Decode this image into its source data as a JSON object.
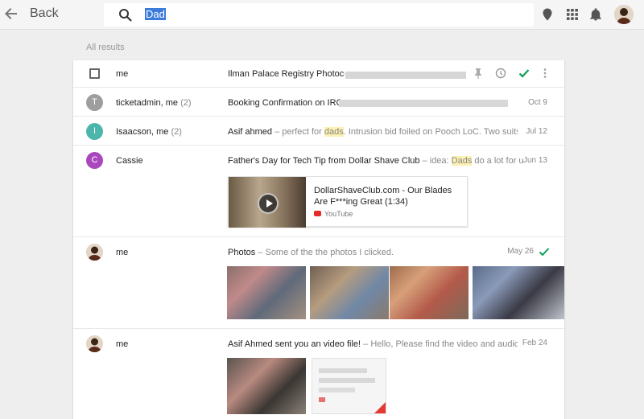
{
  "topbar": {
    "back_label": "Back",
    "search_value": "Dad",
    "icons": [
      "back-arrow-icon",
      "search-icon",
      "location-pin-icon",
      "apps-grid-icon",
      "notifications-bell-icon",
      "user-avatar"
    ]
  },
  "section_label": "All results",
  "rows": [
    {
      "sender": "me",
      "subject": "Ilman Palace Registry Photocopy",
      "snippet": "",
      "date": ""
    },
    {
      "sender": "ticketadmin, me",
      "count": "(2)",
      "avatar_letter": "T",
      "avatar_color": "#9e9e9e",
      "subject": "Booking Confirmation on IRCT",
      "date": "Oct 9"
    },
    {
      "sender": "Isaacson, me",
      "count": "(2)",
      "avatar_letter": "I",
      "avatar_color": "#4db6ac",
      "subject": "Asif ahmed",
      "snippet_pre": " – perfect for ",
      "snippet_hl": "dads",
      "snippet_post": ". Intrusion bid foiled on Pooch LoC. Two suits filed by",
      "date": "Jul 12"
    },
    {
      "sender": "Cassie",
      "avatar_letter": "C",
      "avatar_color": "#ab47bc",
      "subject": "Father's Day for Tech Tip from Dollar Shave Club",
      "snippet_pre": " – idea: ",
      "snippet_hl": "Dads",
      "snippet_post": " do a lot for us, and t...",
      "date": "Jun 13",
      "attachment": {
        "title": "DollarShaveClub.com - Our Blades Are F***ing Great (1:34)",
        "source": "YouTube"
      }
    },
    {
      "sender": "me",
      "subject": "Photos",
      "snippet": " – Some of the the photos I clicked.",
      "date": "May 26"
    },
    {
      "sender": "me",
      "subject": "Asif Ahmed sent you an video file!",
      "snippet": " – Hello, Please find the video and audio a photo ...",
      "date": "Feb 24"
    }
  ],
  "colors": {
    "accent_green": "#0f9d58",
    "youtube_red": "#e52d27",
    "highlight": "#fcf1b3"
  }
}
